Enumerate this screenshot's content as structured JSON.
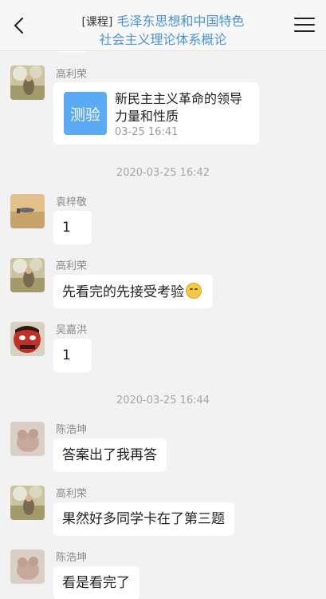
{
  "header": {
    "title_tag": "[课程]",
    "title_line1": "毛泽东思想和中国特色",
    "title_line2": "社会主义理论体系概论"
  },
  "messages": [
    {
      "sender": "高利荣",
      "type": "quiz",
      "quiz_icon_label": "测验",
      "quiz_title": "新民主主义革命的领导力量和性质",
      "quiz_time": "03-25 16:41"
    },
    {
      "timestamp": "2020-03-25 16:42"
    },
    {
      "sender": "袁梓敬",
      "text": "1"
    },
    {
      "sender": "高利荣",
      "text": "先看完的先接受考验",
      "emoji": "face-emoji-icon"
    },
    {
      "sender": "吴嘉洪",
      "text": "1"
    },
    {
      "timestamp": "2020-03-25 16:44"
    },
    {
      "sender": "陈浩坤",
      "text": "答案出了我再答"
    },
    {
      "sender": "高利荣",
      "text": "果然好多同学卡在了第三题"
    },
    {
      "sender": "陈浩坤",
      "text": "看是看完了"
    }
  ],
  "colors": {
    "accent": "#4b93d3",
    "quiz_icon_bg": "#5aaaf5",
    "background": "#f2f2f2"
  }
}
